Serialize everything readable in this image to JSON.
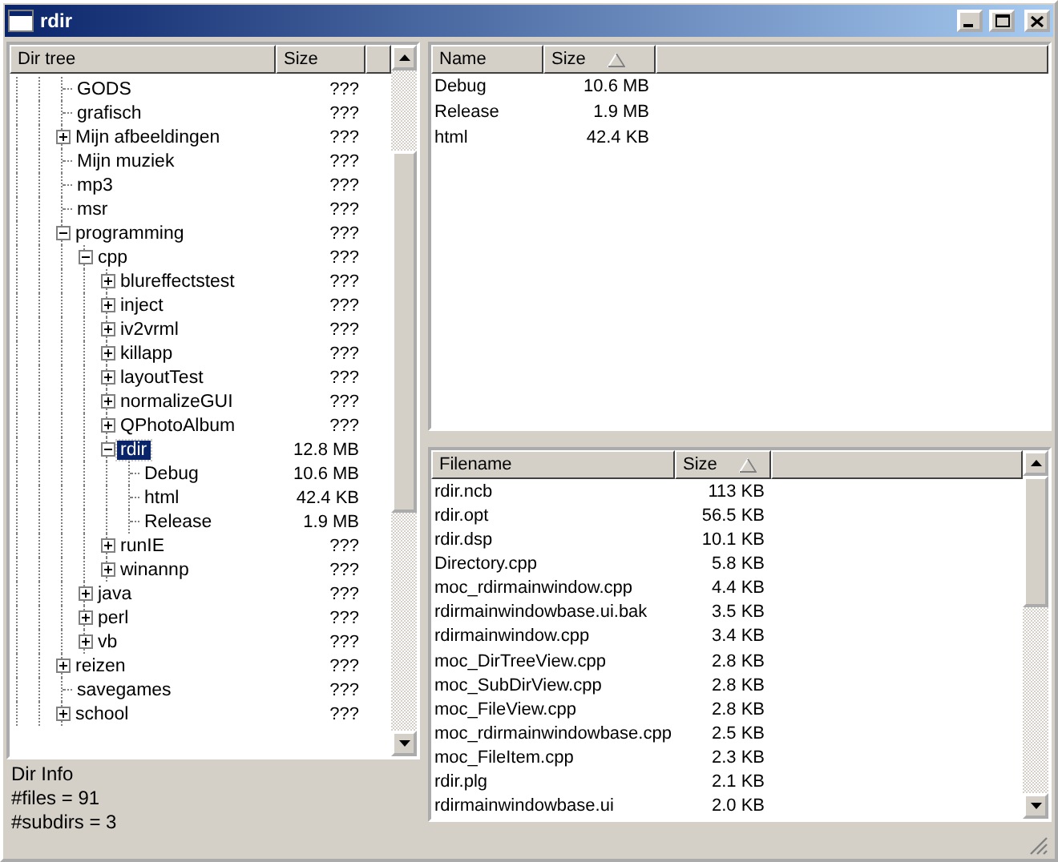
{
  "window": {
    "title": "rdir"
  },
  "dir_tree": {
    "columns": [
      "Dir tree",
      "Size"
    ],
    "items": [
      {
        "name": "GODS",
        "size": "???",
        "selected": false
      },
      {
        "name": "grafisch",
        "size": "???",
        "selected": false
      },
      {
        "name": "Mijn afbeeldingen",
        "size": "???",
        "selected": false,
        "expanded": false
      },
      {
        "name": "Mijn muziek",
        "size": "???",
        "selected": false
      },
      {
        "name": "mp3",
        "size": "???",
        "selected": false
      },
      {
        "name": "msr",
        "size": "???",
        "selected": false
      },
      {
        "name": "programming",
        "size": "???",
        "selected": false,
        "expanded": true,
        "children": [
          {
            "name": "cpp",
            "size": "???",
            "selected": false,
            "expanded": true,
            "children": [
              {
                "name": "blureffectstest",
                "size": "???",
                "selected": false,
                "expanded": false
              },
              {
                "name": "inject",
                "size": "???",
                "selected": false,
                "expanded": false
              },
              {
                "name": "iv2vrml",
                "size": "???",
                "selected": false,
                "expanded": false
              },
              {
                "name": "killapp",
                "size": "???",
                "selected": false,
                "expanded": false
              },
              {
                "name": "layoutTest",
                "size": "???",
                "selected": false,
                "expanded": false
              },
              {
                "name": "normalizeGUI",
                "size": "???",
                "selected": false,
                "expanded": false
              },
              {
                "name": "QPhotoAlbum",
                "size": "???",
                "selected": false,
                "expanded": false
              },
              {
                "name": "rdir",
                "size": "12.8 MB",
                "selected": true,
                "expanded": true,
                "children": [
                  {
                    "name": "Debug",
                    "size": "10.6 MB",
                    "selected": false
                  },
                  {
                    "name": "html",
                    "size": "42.4 KB",
                    "selected": false
                  },
                  {
                    "name": "Release",
                    "size": "1.9 MB",
                    "selected": false
                  }
                ]
              },
              {
                "name": "runIE",
                "size": "???",
                "selected": false,
                "expanded": false
              },
              {
                "name": "winannp",
                "size": "???",
                "selected": false,
                "expanded": false
              }
            ]
          },
          {
            "name": "java",
            "size": "???",
            "selected": false,
            "expanded": false
          },
          {
            "name": "perl",
            "size": "???",
            "selected": false,
            "expanded": false
          },
          {
            "name": "vb",
            "size": "???",
            "selected": false,
            "expanded": false
          }
        ]
      },
      {
        "name": "reizen",
        "size": "???",
        "selected": false,
        "expanded": false
      },
      {
        "name": "savegames",
        "size": "???",
        "selected": false
      },
      {
        "name": "school",
        "size": "???",
        "selected": false,
        "expanded": false
      }
    ]
  },
  "dir_info": [
    "Dir Info",
    "#files = 91",
    "#subdirs = 3"
  ],
  "subdir_list": {
    "columns": [
      "Name",
      "Size"
    ],
    "rows": [
      {
        "name": "Debug",
        "size": "10.6 MB"
      },
      {
        "name": "Release",
        "size": "1.9 MB"
      },
      {
        "name": "html",
        "size": "42.4 KB"
      }
    ]
  },
  "file_list": {
    "columns": [
      "Filename",
      "Size"
    ],
    "rows": [
      {
        "name": "rdir.ncb",
        "size": "113 KB"
      },
      {
        "name": "rdir.opt",
        "size": "56.5 KB"
      },
      {
        "name": "rdir.dsp",
        "size": "10.1 KB"
      },
      {
        "name": "Directory.cpp",
        "size": "5.8 KB"
      },
      {
        "name": "moc_rdirmainwindow.cpp",
        "size": "4.4 KB"
      },
      {
        "name": "rdirmainwindowbase.ui.bak",
        "size": "3.5 KB"
      },
      {
        "name": "rdirmainwindow.cpp",
        "size": "3.4 KB"
      },
      {
        "name": "moc_DirTreeView.cpp",
        "size": "2.8 KB"
      },
      {
        "name": "moc_SubDirView.cpp",
        "size": "2.8 KB"
      },
      {
        "name": "moc_FileView.cpp",
        "size": "2.8 KB"
      },
      {
        "name": "moc_rdirmainwindowbase.cpp",
        "size": "2.5 KB"
      },
      {
        "name": "moc_FileItem.cpp",
        "size": "2.3 KB"
      },
      {
        "name": "rdir.plg",
        "size": "2.1 KB"
      },
      {
        "name": "rdirmainwindowbase.ui",
        "size": "2.0 KB"
      }
    ]
  }
}
